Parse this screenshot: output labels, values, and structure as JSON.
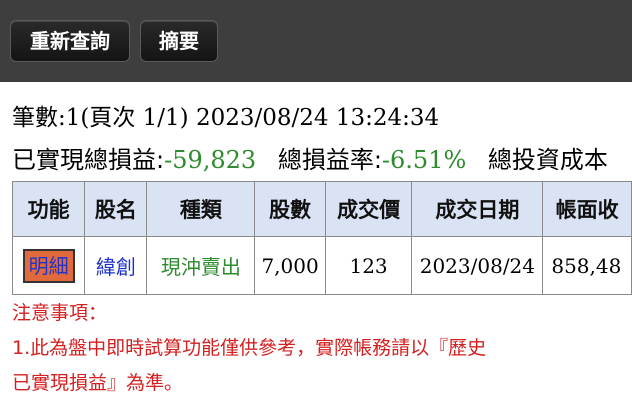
{
  "toolbar": {
    "requery_label": "重新查詢",
    "summary_label": "摘要"
  },
  "info": {
    "records_line": "筆數:1(頁次 1/1) 2023/08/24 13:24:34",
    "realized_pl_label": "已實現總損益:",
    "realized_pl_value": "-59,823",
    "pl_rate_label": "總損益率:",
    "pl_rate_value": "-6.51%",
    "total_cost_label": "總投資成本"
  },
  "table": {
    "headers": [
      "功能",
      "股名",
      "種類",
      "股數",
      "成交價",
      "成交日期",
      "帳面收"
    ],
    "row": {
      "action": "明細",
      "stock": "緯創",
      "type": "現沖賣出",
      "shares": "7,000",
      "price": "123",
      "date": "2023/08/24",
      "book": "858,48"
    }
  },
  "notes": {
    "title": "注意事項：",
    "line1": "1.此為盤中即時試算功能僅供參考，實際帳務請以『歷史",
    "line2": "已實現損益』為準。"
  },
  "colors": {
    "topbar": "#3e3e3e",
    "header_bg": "#dae3f3",
    "negative": "#2e8b2e",
    "stock_link": "#1a2fcc",
    "note_text": "#d42020",
    "detail_button": "#e06a3c"
  }
}
